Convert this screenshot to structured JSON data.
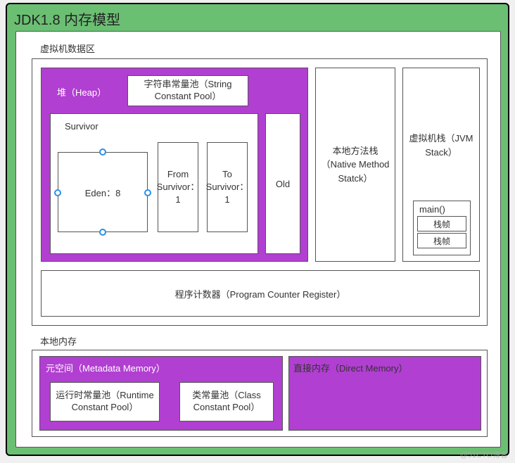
{
  "title": "JDK1.8 内存模型",
  "vm_data_area_label": "虚拟机数据区",
  "heap": {
    "label": "堆（Heap）",
    "string_pool": "字符串常量池（String Constant Pool）",
    "survivor_label": "Survivor",
    "eden": "Eden：8",
    "from": "From Survivor：1",
    "to": "To Survivor：1",
    "old": "Old"
  },
  "native_stack": "本地方法栈（Native Method Statck）",
  "jvm_stack": {
    "label": "虚拟机栈（JVM Stack）",
    "main": "main()",
    "frame1": "栈帧",
    "frame2": "栈帧"
  },
  "pcr": "程序计数器（Program Counter Register）",
  "local_mem_label": "本地内存",
  "metaspace": {
    "label": "元空间（Metadata Memory）",
    "runtime_pool": "运行时常量池（Runtime Constant Pool）",
    "class_pool": "类常量池（Class Constant Pool）"
  },
  "direct_mem": "直接内存（Direct Memory）",
  "watermark": "@51CTO博客"
}
